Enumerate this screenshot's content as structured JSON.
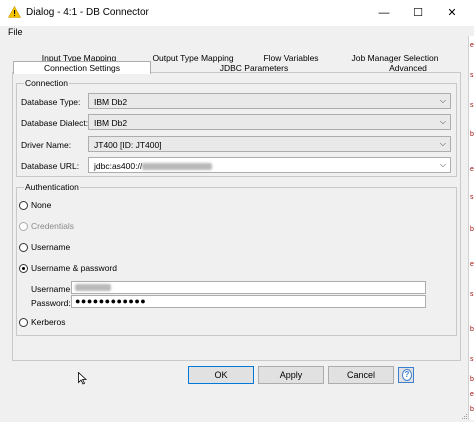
{
  "window": {
    "title": "Dialog - 4:1 - DB Connector",
    "minimize": "—",
    "maximize": "☐",
    "close": "✕"
  },
  "menu": {
    "file": "File"
  },
  "tabs": {
    "row1": [
      "Input Type Mapping",
      "Output Type Mapping",
      "Flow Variables",
      "Job Manager Selection"
    ],
    "row2": [
      "Connection Settings",
      "JDBC Parameters",
      "Advanced"
    ],
    "active": "Connection Settings"
  },
  "connection": {
    "title": "Connection",
    "database_type": {
      "label": "Database Type:",
      "value": "IBM Db2"
    },
    "database_dialect": {
      "label": "Database Dialect:",
      "value": "IBM Db2"
    },
    "driver_name": {
      "label": "Driver Name:",
      "value": "JT400 [ID: JT400]"
    },
    "database_url": {
      "label": "Database URL:",
      "value": "jdbc:as400://"
    }
  },
  "authentication": {
    "title": "Authentication",
    "options": [
      "None",
      "Credentials",
      "Username",
      "Username & password",
      "Kerberos"
    ],
    "selected": "Username & password",
    "username_label": "Username:",
    "password_label": "Password:",
    "password_value": "●●●●●●●●●●●●"
  },
  "buttons": {
    "ok": "OK",
    "apply": "Apply",
    "cancel": "Cancel",
    "help": "?"
  },
  "edge_glyphs": [
    "e",
    "s",
    "s",
    "b",
    "e",
    "s",
    "b",
    "e",
    "s",
    "b",
    "s",
    "b",
    "e",
    "b"
  ],
  "colors": {
    "accent": "#0078d7",
    "warning_icon": "#f5c400",
    "help_icon": "#3c7fd1"
  }
}
